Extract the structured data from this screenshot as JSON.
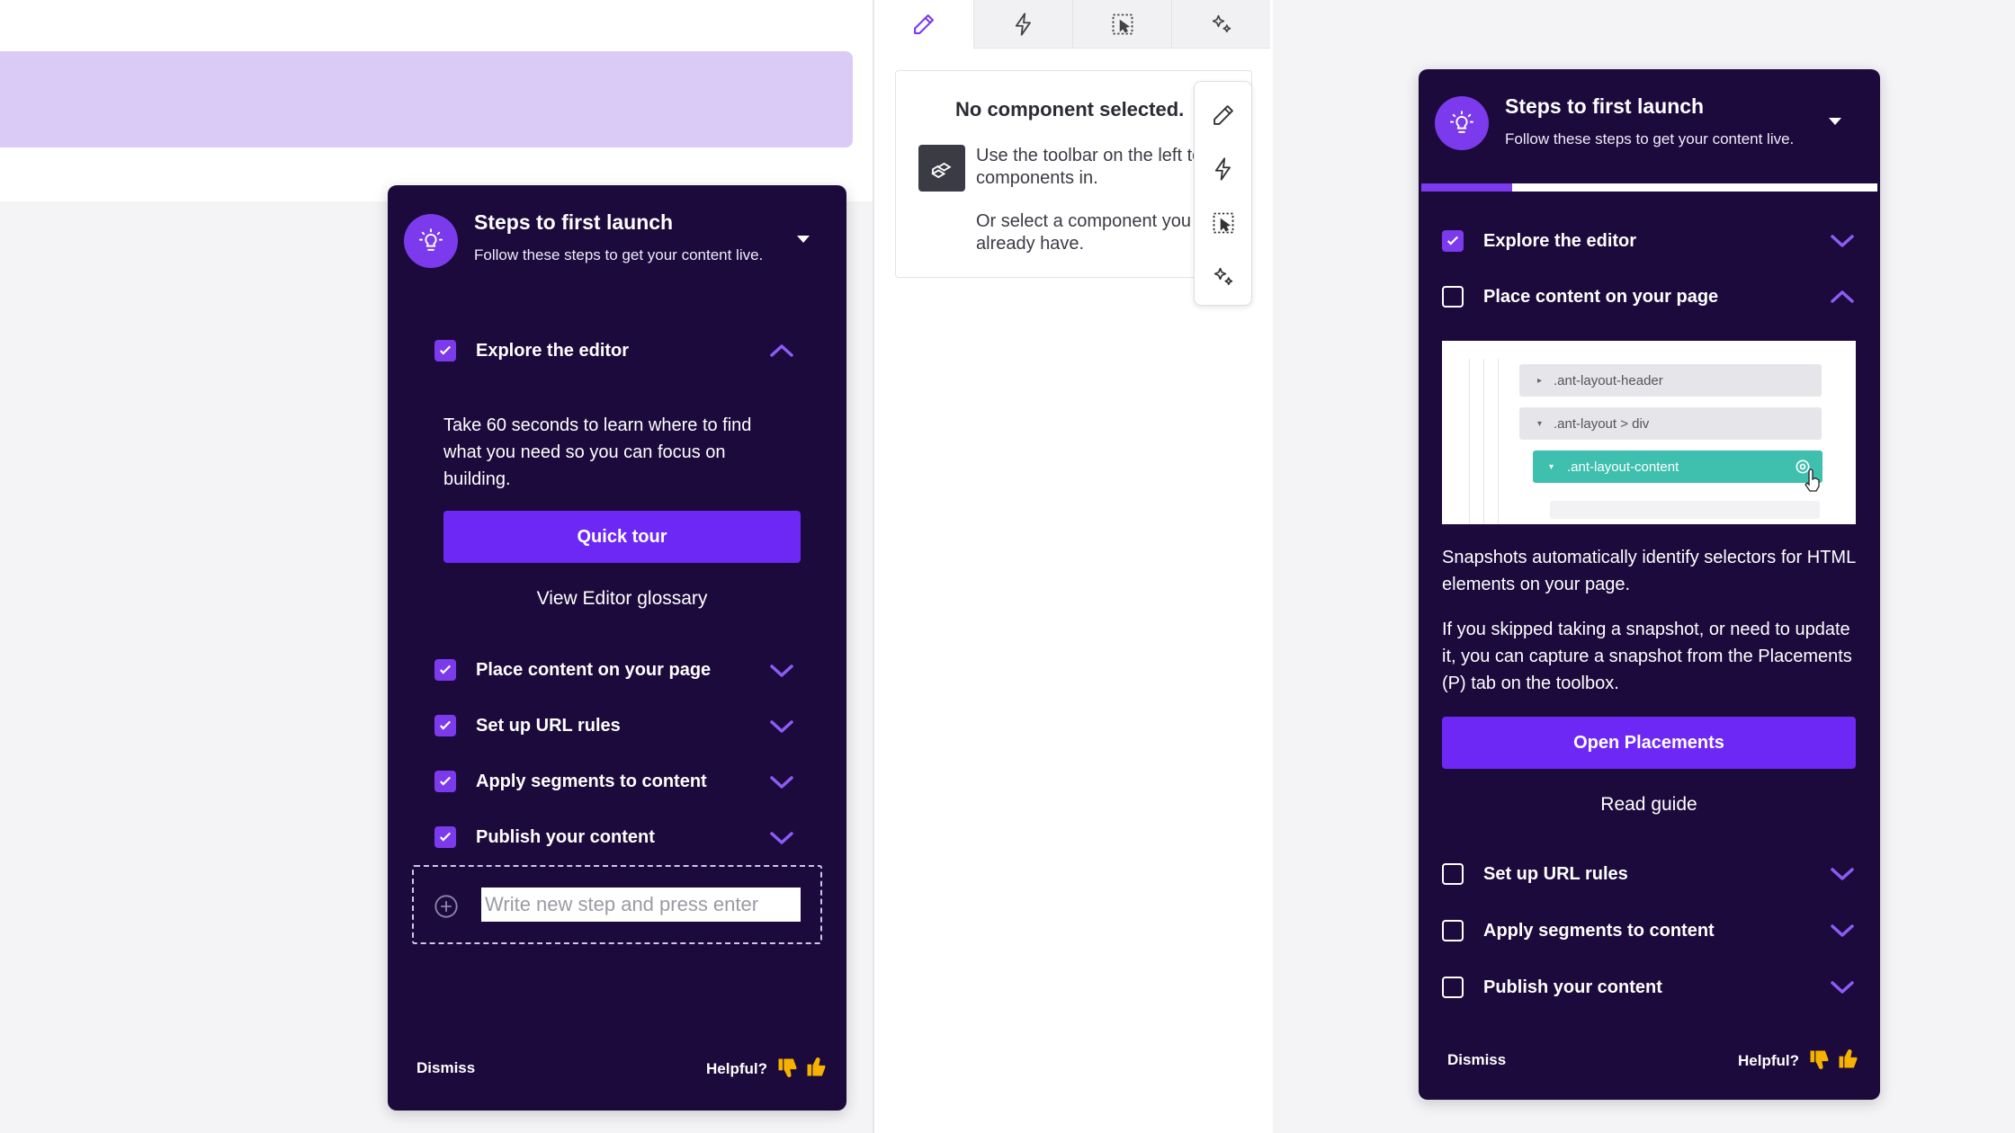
{
  "editor": {
    "tabs": [
      {
        "name": "edit",
        "icon": "pencil-icon"
      },
      {
        "name": "actions",
        "icon": "lightning-icon"
      },
      {
        "name": "placements",
        "icon": "select-element-icon"
      },
      {
        "name": "magic",
        "icon": "sparkle-icon"
      }
    ],
    "empty_title": "No component selected.",
    "empty_text1": "Use the toolbar on the left to drag components in.",
    "empty_text2": "Or select a component you already have."
  },
  "left_card": {
    "title": "Steps to first launch",
    "subtitle": "Follow these steps to get your content live.",
    "steps": [
      {
        "label": "Explore the editor",
        "checked": true,
        "expanded": true
      },
      {
        "label": "Place content on your page",
        "checked": true,
        "expanded": false
      },
      {
        "label": "Set up URL rules",
        "checked": true,
        "expanded": false
      },
      {
        "label": "Apply segments to content",
        "checked": true,
        "expanded": false
      },
      {
        "label": "Publish your content",
        "checked": true,
        "expanded": false
      }
    ],
    "explore_body": "Take 60 seconds to learn where to find what you need so you can focus on building.",
    "quick_tour": "Quick tour",
    "glossary_link": "View Editor glossary",
    "new_step_placeholder": "Write new step and press enter",
    "dismiss": "Dismiss",
    "helpful": "Helpful?"
  },
  "right_card": {
    "title": "Steps to first launch",
    "subtitle": "Follow these steps to get your content live.",
    "progress": 0.2,
    "steps": [
      {
        "label": "Explore the editor",
        "checked": true,
        "expanded": false
      },
      {
        "label": "Place content on your page",
        "checked": false,
        "expanded": true
      },
      {
        "label": "Set up URL rules",
        "checked": false,
        "expanded": false
      },
      {
        "label": "Apply segments to content",
        "checked": false,
        "expanded": false
      },
      {
        "label": "Publish your content",
        "checked": false,
        "expanded": false
      }
    ],
    "snapshot": {
      "row1": ".ant-layout-header",
      "row2": ".ant-layout > div",
      "row3": ".ant-layout-content"
    },
    "place_body1": "Snapshots automatically identify selectors for HTML elements on your page.",
    "place_body2": "If you skipped taking a snapshot, or need to update it, you can capture a snapshot from the Placements (P) tab on the toolbox.",
    "open_placements": "Open Placements",
    "read_guide": "Read guide",
    "dismiss": "Dismiss",
    "helpful": "Helpful?"
  },
  "colors": {
    "card_bg": "#1b0a3b",
    "accent": "#7c3aed",
    "button": "#6d28f5",
    "lavender_bar": "#dacbf6",
    "snapshot_teal": "#3fbfae"
  }
}
